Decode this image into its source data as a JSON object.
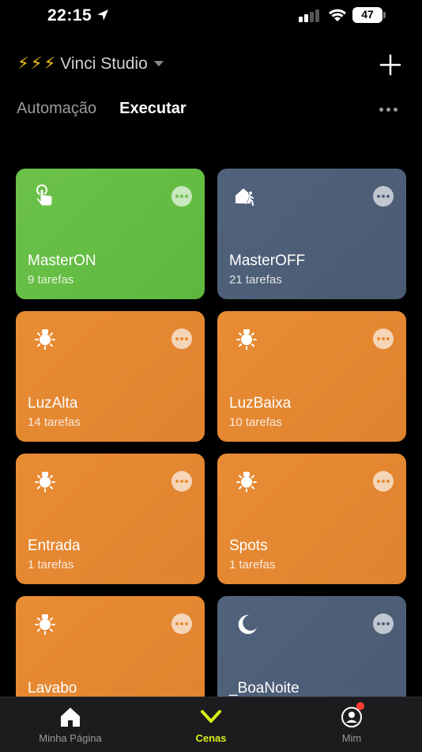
{
  "status_bar": {
    "time": "22:15",
    "battery": "47",
    "icons": [
      "location-arrow-icon",
      "signal-icon",
      "wifi-icon",
      "battery-icon"
    ]
  },
  "header": {
    "bolts": "⚡⚡⚡",
    "home_name": "Vinci Studio",
    "add_icon": "plus-icon"
  },
  "tabs": [
    {
      "label": "Automação",
      "active": false
    },
    {
      "label": "Executar",
      "active": true
    }
  ],
  "scenes": [
    {
      "name": "MasterON",
      "count": "9 tarefas",
      "color": "#6cc24a",
      "icon": "touch-hand-icon",
      "more_dot_color": "#6cc24a"
    },
    {
      "name": "MasterOFF",
      "count": "21 tarefas",
      "color": "#51627c",
      "icon": "leave-home-icon",
      "more_dot_color": "#51627c"
    },
    {
      "name": "LuzAlta",
      "count": "14 tarefas",
      "color": "#e88c34",
      "icon": "lightbulb-icon",
      "more_dot_color": "#e88c34"
    },
    {
      "name": "LuzBaixa",
      "count": "10 tarefas",
      "color": "#e88c34",
      "icon": "lightbulb-icon",
      "more_dot_color": "#e88c34"
    },
    {
      "name": "Entrada",
      "count": "1 tarefas",
      "color": "#e88c34",
      "icon": "lightbulb-icon",
      "more_dot_color": "#e88c34"
    },
    {
      "name": "Spots",
      "count": "1 tarefas",
      "color": "#e88c34",
      "icon": "lightbulb-icon",
      "more_dot_color": "#e88c34"
    },
    {
      "name": "Lavabo",
      "count": "",
      "color": "#e88c34",
      "icon": "lightbulb-icon",
      "more_dot_color": "#e88c34"
    },
    {
      "name": "_BoaNoite",
      "count": "",
      "color": "#51627c",
      "icon": "moon-icon",
      "more_dot_color": "#51627c"
    }
  ],
  "tab_bar": [
    {
      "label": "Minha Página",
      "icon": "home-icon",
      "active": false
    },
    {
      "label": "Cenas",
      "icon": "chevron-down-icon",
      "active": true
    },
    {
      "label": "Mim",
      "icon": "profile-icon",
      "active": false,
      "badge": true
    }
  ],
  "colors": {
    "accent": "#d7ef17",
    "badge": "#ff3b30",
    "bolt": "#f2c318"
  }
}
